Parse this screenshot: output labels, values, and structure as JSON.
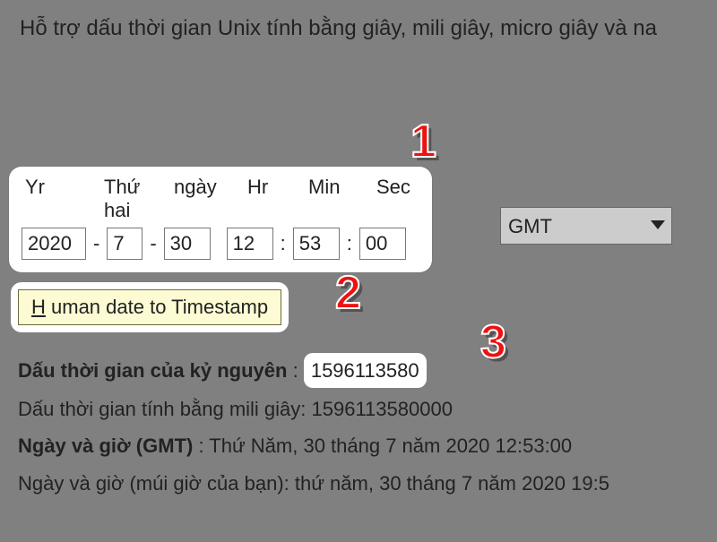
{
  "intro": "Hỗ trợ dấu thời gian Unix tính bằng giây, mili giây, micro giây và na",
  "labels": {
    "yr": "Yr",
    "thu": "Thứ hai",
    "ngay": "ngày",
    "hr": "Hr",
    "min": "Min",
    "sec": "Sec"
  },
  "fields": {
    "year": "2020",
    "month": "7",
    "day": "30",
    "hr": "12",
    "min": "53",
    "sec": "00",
    "sep": "-",
    "colon": ":"
  },
  "tz": {
    "selected": "GMT",
    "options": [
      "GMT"
    ]
  },
  "button": {
    "h": "H",
    "rest": " uman date to Timestamp"
  },
  "callouts": {
    "c1": "1",
    "c2": "2",
    "c3": "3"
  },
  "results": {
    "epoch_label": "Dấu thời gian của kỷ nguyên",
    "epoch_sep": " : ",
    "epoch_value": "1596113580",
    "ms_line": "Dấu thời gian tính bằng mili giây: 1596113580000",
    "gmt_label": "Ngày và giờ (GMT)",
    "gmt_rest": " : Thứ Năm, 30 tháng 7 năm 2020 12:53:00",
    "local_line": "Ngày và giờ (múi giờ của bạn): thứ năm, 30 tháng 7 năm 2020 19:5"
  }
}
